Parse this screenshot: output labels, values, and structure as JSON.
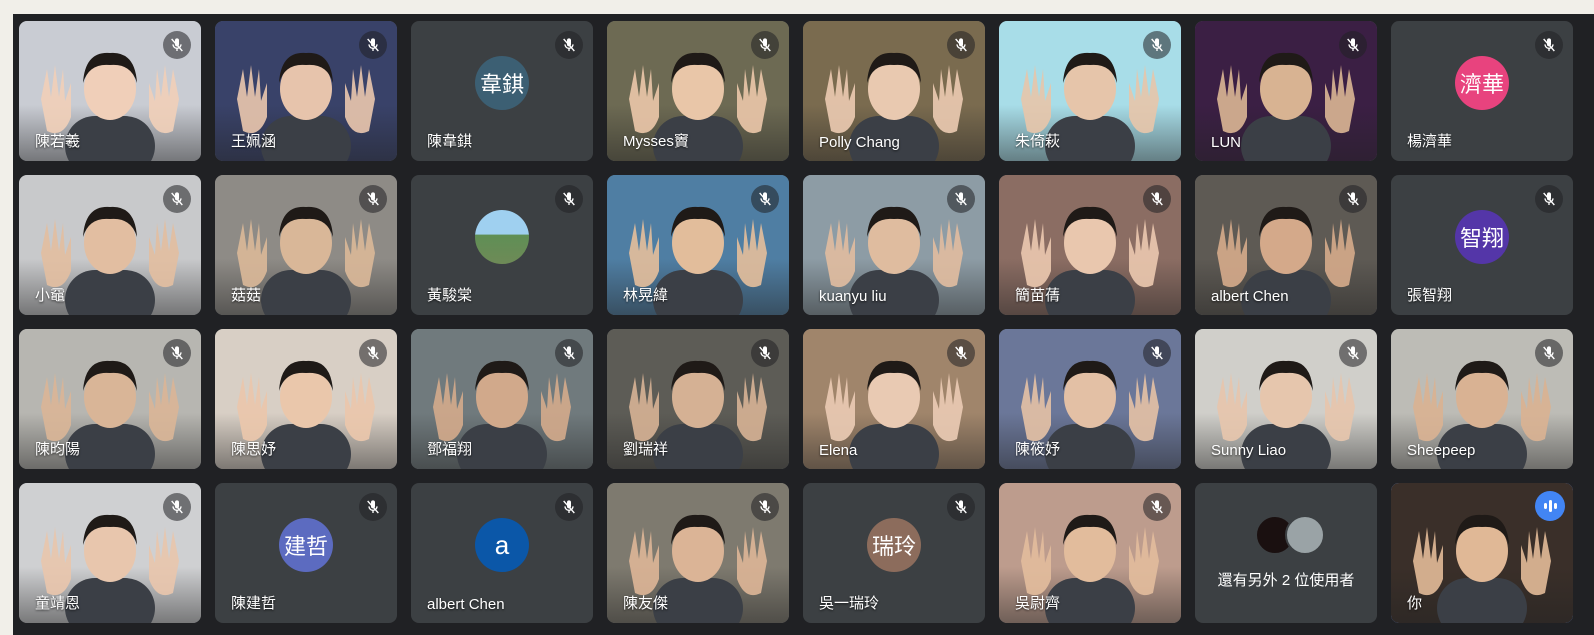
{
  "meeting": {
    "participants": [
      {
        "name": "陳若羲",
        "type": "video",
        "muted": true,
        "bg": "#c9ccd3",
        "skin": "#f0cfb9"
      },
      {
        "name": "王姵涵",
        "type": "video",
        "muted": true,
        "bg": "#394269",
        "skin": "#e7c4ac"
      },
      {
        "name": "陳韋錤",
        "type": "avatar",
        "initials": "韋錤",
        "avatar_color": "#3c5f73",
        "muted": true
      },
      {
        "name": "Mysses竇",
        "type": "video",
        "muted": true,
        "bg": "#6d6a53",
        "skin": "#e9c6a8"
      },
      {
        "name": "Polly Chang",
        "type": "video",
        "muted": true,
        "bg": "#7a6b4f",
        "skin": "#e9c9b0"
      },
      {
        "name": "朱倚萩",
        "type": "video",
        "muted": true,
        "bg": "#a8dde8",
        "skin": "#e6c5aa"
      },
      {
        "name": "LUN",
        "type": "video",
        "muted": true,
        "bg": "#3b1f44",
        "skin": "#d8b392"
      },
      {
        "name": "楊濟華",
        "type": "avatar",
        "initials": "濟華",
        "avatar_color": "#e8437e",
        "muted": true
      },
      {
        "name": "小黿",
        "type": "video",
        "muted": true,
        "bg": "#c8c9cb",
        "skin": "#e2bea1"
      },
      {
        "name": "菇菇",
        "type": "video",
        "muted": true,
        "bg": "#8e8b86",
        "skin": "#d9b798"
      },
      {
        "name": "黃駿棠",
        "type": "avatar",
        "initials": "",
        "avatar_color": "#6aa4d8",
        "muted": true
      },
      {
        "name": "林晃緯",
        "type": "video",
        "muted": true,
        "bg": "#4f7ea3",
        "skin": "#e2bd9b"
      },
      {
        "name": "kuanyu liu",
        "type": "video",
        "muted": true,
        "bg": "#8d9ca5",
        "skin": "#dfbc9f"
      },
      {
        "name": "簡苗蒨",
        "type": "video",
        "muted": true,
        "bg": "#8b6d63",
        "skin": "#e9c7ae"
      },
      {
        "name": "albert Chen",
        "type": "video",
        "muted": true,
        "bg": "#5e5a54",
        "skin": "#d4a98a"
      },
      {
        "name": "張智翔",
        "type": "avatar",
        "initials": "智翔",
        "avatar_color": "#5436a8",
        "muted": true
      },
      {
        "name": "陳昀陽",
        "type": "video",
        "muted": true,
        "bg": "#b7b6b1",
        "skin": "#d9b597"
      },
      {
        "name": "陳思妤",
        "type": "video",
        "muted": true,
        "bg": "#d8cfc5",
        "skin": "#eac7ab"
      },
      {
        "name": "鄧福翔",
        "type": "video",
        "muted": true,
        "bg": "#707a7d",
        "skin": "#d1a98b"
      },
      {
        "name": "劉瑞祥",
        "type": "video",
        "muted": true,
        "bg": "#5d5c56",
        "skin": "#d5b194"
      },
      {
        "name": "Elena",
        "type": "video",
        "muted": true,
        "bg": "#a0856b",
        "skin": "#e9cab3"
      },
      {
        "name": "陳筱妤",
        "type": "video",
        "muted": true,
        "bg": "#6b7799",
        "skin": "#e3c0a5"
      },
      {
        "name": "Sunny Liao",
        "type": "video",
        "muted": true,
        "bg": "#d0cfca",
        "skin": "#e6c6ad"
      },
      {
        "name": "Sheepeep",
        "type": "video",
        "muted": true,
        "bg": "#bdbcb6",
        "skin": "#d9b293"
      },
      {
        "name": "童靖恩",
        "type": "video",
        "muted": true,
        "bg": "#cfd0d2",
        "skin": "#e8c6ad"
      },
      {
        "name": "陳建哲",
        "type": "avatar",
        "initials": "建哲",
        "avatar_color": "#5c6bc0",
        "muted": true
      },
      {
        "name": "albert Chen",
        "type": "avatar",
        "initials": "a",
        "avatar_color": "#0b57a8",
        "muted": true
      },
      {
        "name": "陳友傑",
        "type": "video",
        "muted": true,
        "bg": "#7e7a6f",
        "skin": "#dbb496"
      },
      {
        "name": "吳一瑞玲",
        "type": "avatar",
        "initials": "瑞玲",
        "avatar_color": "#8c6c5c",
        "muted": true
      },
      {
        "name": "吳尉齊",
        "type": "video",
        "muted": true,
        "bg": "#bd9c8d",
        "skin": "#e2bc9c"
      },
      {
        "name": "還有另外 2 位使用者",
        "type": "more",
        "muted": false
      },
      {
        "name": "你",
        "type": "video",
        "muted": false,
        "self": true,
        "bg": "#3a2f29",
        "skin": "#e0b896"
      }
    ]
  }
}
